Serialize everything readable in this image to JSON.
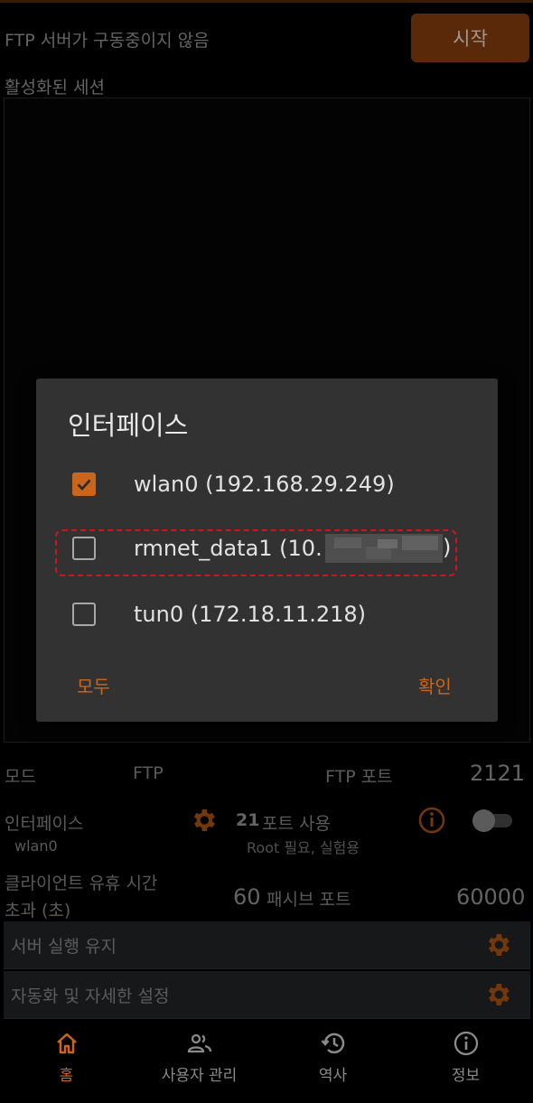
{
  "header": {
    "status_text": "FTP 서버가 구동중이지 않음",
    "start_label": "시작"
  },
  "sessions": {
    "label": "활성화된 세션"
  },
  "settings": {
    "mode_label": "모드",
    "mode_value": "FTP",
    "ftp_port_label": "FTP 포트",
    "ftp_port_value": "2121",
    "interface_label": "인터페이스",
    "interface_value": "wlan0",
    "port21_value": "21",
    "port21_label": "포트 사용",
    "port21_sub": "Root 필요, 실험용",
    "idle_label_line1": "클라이언트 유휴 시간",
    "idle_label_line2": "초과 (초)",
    "idle_value": "60",
    "passive_label": "패시브 포트",
    "passive_value": "60000",
    "keep_running_label": "서버 실행 유지",
    "advanced_label": "자동화 및 자세한 설정",
    "port21_enabled": false
  },
  "dialog": {
    "title": "인터페이스",
    "options": [
      {
        "label": "wlan0 (192.168.29.249)",
        "checked": true
      },
      {
        "label": "rmnet_data1 (10.",
        "suffix": ")",
        "checked": false,
        "redacted": true
      },
      {
        "label": "tun0 (172.18.11.218)",
        "checked": false
      }
    ],
    "all_button": "모두",
    "ok_button": "확인"
  },
  "nav": {
    "items": [
      {
        "label": "홈",
        "icon": "home-icon",
        "active": true
      },
      {
        "label": "사용자 관리",
        "icon": "users-icon",
        "active": false
      },
      {
        "label": "역사",
        "icon": "history-icon",
        "active": false
      },
      {
        "label": "정보",
        "icon": "info-icon",
        "active": false
      }
    ]
  },
  "colors": {
    "accent": "#c9661c",
    "start_button": "#8a3f10",
    "dialog_bg": "#323232",
    "highlight_dash": "#d0141e"
  }
}
